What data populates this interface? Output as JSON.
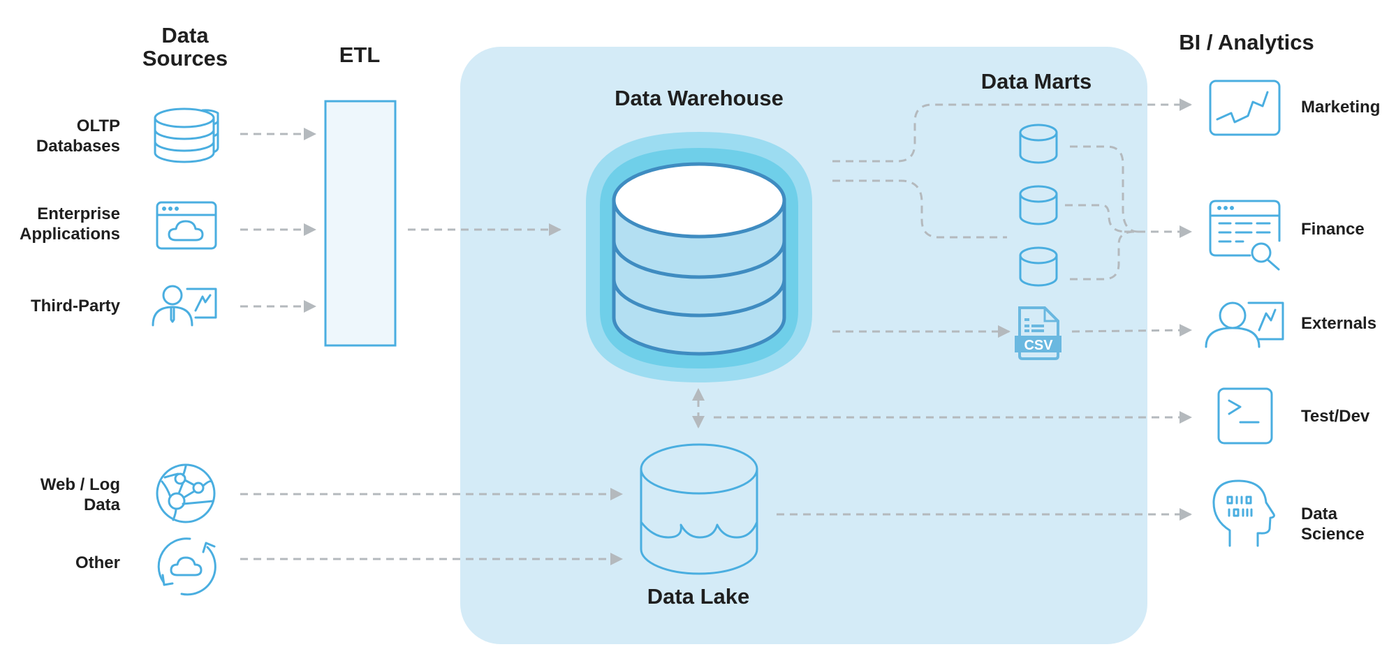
{
  "sections": {
    "data_sources": "Data\nSources",
    "etl": "ETL",
    "data_warehouse": "Data Warehouse",
    "data_marts": "Data Marts",
    "data_lake": "Data Lake",
    "bi_analytics": "BI / Analytics"
  },
  "sources": [
    {
      "label": "OLTP\nDatabases",
      "icon": "database-stack-icon"
    },
    {
      "label": "Enterprise\nApplications",
      "icon": "app-cloud-icon"
    },
    {
      "label": "Third-Party",
      "icon": "presenter-chart-icon"
    },
    {
      "label": "Web / Log\nData",
      "icon": "network-globe-icon"
    },
    {
      "label": "Other",
      "icon": "cloud-sync-icon"
    }
  ],
  "consumers": [
    {
      "label": "Marketing",
      "icon": "trend-chart-icon"
    },
    {
      "label": "Finance",
      "icon": "report-search-icon"
    },
    {
      "label": "Externals",
      "icon": "presenter-chart-icon"
    },
    {
      "label": "Test/Dev",
      "icon": "terminal-icon"
    },
    {
      "label": "Data\nScience",
      "icon": "brain-head-icon"
    }
  ],
  "csv_label": "CSV",
  "colors": {
    "pane": "#d4ebf7",
    "icon": "#4aaee0",
    "warehouse_outline": "#3f8cc1",
    "warehouse_fill": "#b3dff2",
    "glow_outer": "#9cdcf1",
    "glow_inner": "#6fcfe9",
    "arrow": "#b4b9bd",
    "text": "#1f1f1f"
  }
}
